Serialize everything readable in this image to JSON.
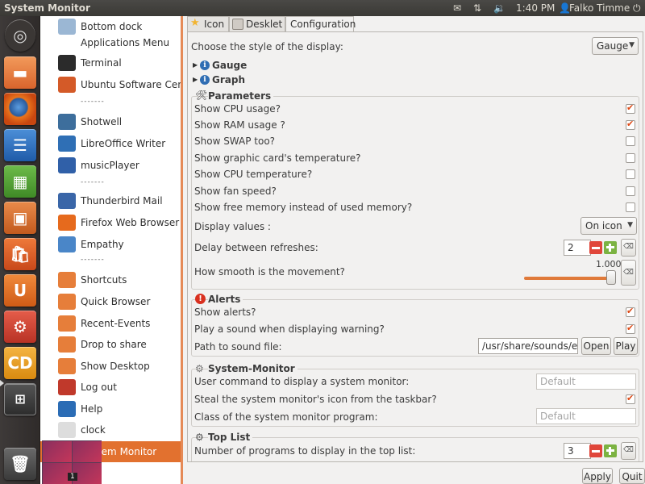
{
  "panel": {
    "title": "System Monitor",
    "time": "1:40 PM",
    "user": "Falko Timme"
  },
  "launcher": [
    {
      "name": "ubuntu-dash-icon"
    },
    {
      "name": "home-folder-icon"
    },
    {
      "name": "firefox-icon"
    },
    {
      "name": "libreoffice-writer-icon"
    },
    {
      "name": "libreoffice-calc-icon"
    },
    {
      "name": "libreoffice-impress-icon"
    },
    {
      "name": "software-center-icon"
    },
    {
      "name": "ubuntu-one-icon"
    },
    {
      "name": "system-settings-icon"
    },
    {
      "name": "cairo-dock-icon"
    },
    {
      "name": "workspace-switcher-icon"
    },
    {
      "name": "trash-icon"
    }
  ],
  "dock_list": {
    "items": [
      {
        "label": "Bottom dock",
        "icon": "dock-icon",
        "color": "#9bb7d4"
      },
      {
        "label": "Applications Menu",
        "icon": "",
        "color": ""
      },
      {
        "label": "Terminal",
        "icon": "terminal-icon",
        "color": "#2b2b2b"
      },
      {
        "label": "Ubuntu Software Cente",
        "icon": "software-center-icon",
        "color": "#d45a28"
      },
      {
        "label": "-------",
        "icon": "",
        "color": ""
      },
      {
        "label": "Shotwell",
        "icon": "shotwell-icon",
        "color": "#3d6e9c"
      },
      {
        "label": "LibreOffice Writer",
        "icon": "writer-icon",
        "color": "#2f6fb5"
      },
      {
        "label": "musicPlayer",
        "icon": "music-player-icon",
        "color": "#3060a8"
      },
      {
        "label": "-------",
        "icon": "",
        "color": ""
      },
      {
        "label": "Thunderbird Mail",
        "icon": "thunderbird-icon",
        "color": "#3a66a8"
      },
      {
        "label": "Firefox Web Browser",
        "icon": "firefox-icon",
        "color": "#e66a1d"
      },
      {
        "label": "Empathy",
        "icon": "empathy-icon",
        "color": "#4a86c8"
      },
      {
        "label": "-------",
        "icon": "",
        "color": ""
      },
      {
        "label": "Shortcuts",
        "icon": "shortcuts-folder-icon",
        "color": "#e67e3a"
      },
      {
        "label": "Quick Browser",
        "icon": "quick-browser-folder-icon",
        "color": "#e67e3a"
      },
      {
        "label": "Recent-Events",
        "icon": "recent-events-folder-icon",
        "color": "#e67e3a"
      },
      {
        "label": "Drop to share",
        "icon": "drop-to-share-icon",
        "color": "#e67e3a"
      },
      {
        "label": "Show Desktop",
        "icon": "show-desktop-icon",
        "color": "#e67e3a"
      },
      {
        "label": "Log out",
        "icon": "logout-icon",
        "color": "#c0392b"
      },
      {
        "label": "Help",
        "icon": "help-icon",
        "color": "#2b6cb5"
      },
      {
        "label": "clock",
        "icon": "clock-icon",
        "color": "#dddddd"
      },
      {
        "label": "System Monitor",
        "icon": "system-monitor-icon",
        "color": "#e2712f"
      }
    ],
    "workspace_badge": "1"
  },
  "tabs": [
    {
      "label": "Icon",
      "icon": "star-icon"
    },
    {
      "label": "Desklet",
      "icon": "desklet-icon"
    },
    {
      "label": "Configuration",
      "icon": ""
    }
  ],
  "config": {
    "display_style_label": "Choose the style of the display:",
    "display_style_value": "Gauge",
    "gauge_label": "Gauge",
    "graph_label": "Graph",
    "parameters_heading": "Parameters",
    "parameters": [
      {
        "label": "Show CPU usage?",
        "checked": true
      },
      {
        "label": "Show RAM usage ?",
        "checked": true
      },
      {
        "label": "Show SWAP too?",
        "checked": false
      },
      {
        "label": "Show graphic card's temperature?",
        "checked": false
      },
      {
        "label": "Show CPU temperature?",
        "checked": false
      },
      {
        "label": "Show fan speed?",
        "checked": false
      },
      {
        "label": "Show free memory instead of used memory?",
        "checked": false
      }
    ],
    "display_values_label": "Display values :",
    "display_values_value": "On icon",
    "delay_label": "Delay between refreshes:",
    "delay_value": "2",
    "smooth_label": "How smooth is the movement?",
    "smooth_value": "1.000",
    "alerts_heading": "Alerts",
    "show_alerts_label": "Show alerts?",
    "show_alerts_checked": true,
    "play_sound_label": "Play a sound when displaying warning?",
    "play_sound_checked": true,
    "sound_path_label": "Path to sound file:",
    "sound_path_value": "/usr/share/sounds/err",
    "open_label": "Open",
    "play_label": "Play",
    "sysmon_heading": "System-Monitor",
    "user_command_label": "User command to display a system monitor:",
    "user_command_placeholder": "Default",
    "steal_icon_label": "Steal the system monitor's icon from the taskbar?",
    "steal_icon_checked": true,
    "class_label": "Class of the system monitor program:",
    "class_placeholder": "Default",
    "toplist_heading": "Top List",
    "programs_count_label": "Number of programs to display in the top list:",
    "programs_count_value": "3"
  },
  "footer": {
    "apply_label": "Apply",
    "quit_label": "Quit"
  },
  "colors": {
    "accent": "#e2712f",
    "check": "#dd4814"
  }
}
